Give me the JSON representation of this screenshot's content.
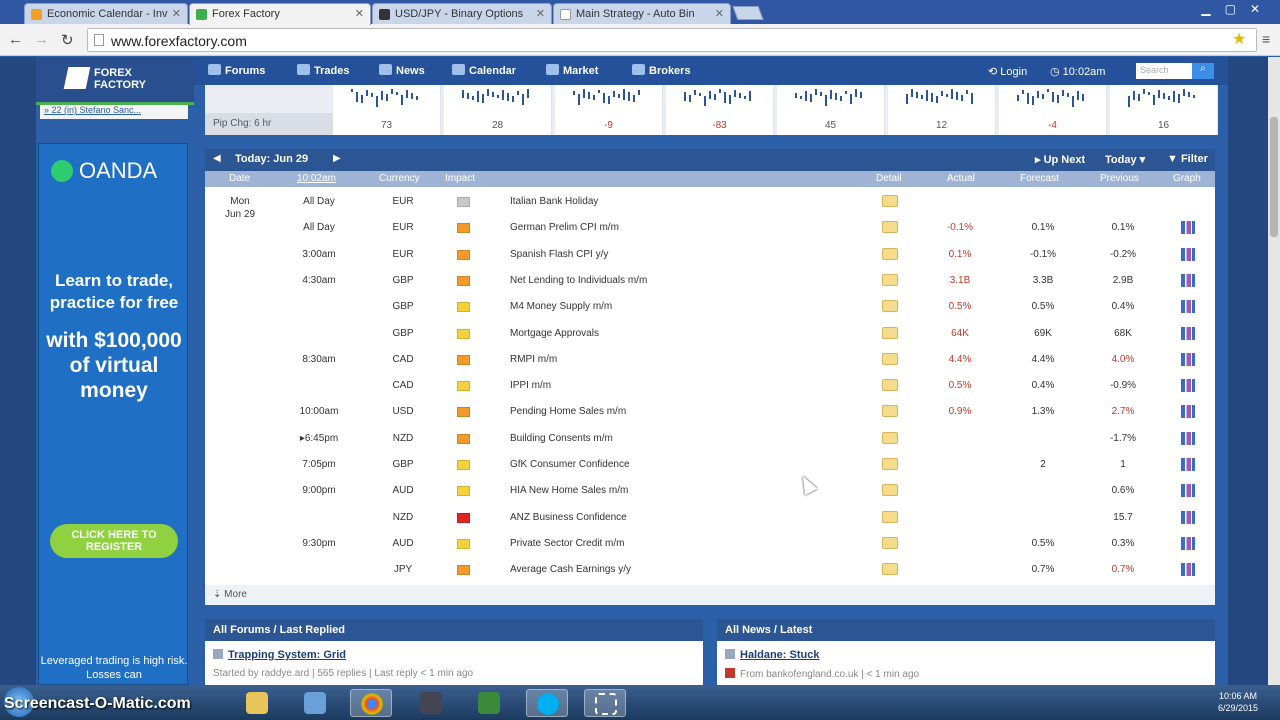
{
  "browser": {
    "tabs": [
      {
        "label": "Economic Calendar - Inv",
        "active": false
      },
      {
        "label": "Forex Factory",
        "active": true
      },
      {
        "label": "USD/JPY - Binary Options",
        "active": false
      },
      {
        "label": "Main Strategy - Auto Bin",
        "active": false
      }
    ],
    "url": "www.forexfactory.com"
  },
  "site": {
    "logo": "FOREX\nFACTORY",
    "nav": [
      "Forums",
      "Trades",
      "News",
      "Calendar",
      "Market",
      "Brokers"
    ],
    "login": "Login",
    "time": "10:02am",
    "search_placeholder": "Search",
    "sidebar_link": "» 22 (in) Stefano Sanc...",
    "pip_label": "Pip Chg: 6 hr",
    "pip_values": [
      "73",
      "28",
      "-9",
      "-83",
      "45",
      "12",
      "-4",
      "16"
    ]
  },
  "ad": {
    "brand": "OANDA",
    "headline": "Learn to trade, practice for free",
    "big": "with $100,000 of virtual money",
    "cta": "CLICK HERE TO REGISTER",
    "risk": "Leveraged trading is high risk. Losses can"
  },
  "calendar": {
    "today": "Today: Jun 29",
    "up_next": "Up Next",
    "today_menu": "Today",
    "filter": "Filter",
    "headers": {
      "date": "Date",
      "time": "10:02am",
      "currency": "Currency",
      "impact": "Impact",
      "detail": "Detail",
      "actual": "Actual",
      "forecast": "Forecast",
      "previous": "Previous",
      "graph": "Graph"
    },
    "day": "Mon\nJun 29",
    "rows": [
      {
        "time": "All Day",
        "cur": "EUR",
        "impact": "gray",
        "event": "Italian Bank Holiday",
        "actual": "",
        "forecast": "",
        "previous": "",
        "prev_mod": false,
        "graph": false
      },
      {
        "time": "All Day",
        "cur": "EUR",
        "impact": "orange",
        "event": "German Prelim CPI m/m",
        "actual": "-0.1%",
        "forecast": "0.1%",
        "previous": "0.1%",
        "prev_mod": false,
        "graph": true
      },
      {
        "time": "3:00am",
        "cur": "EUR",
        "impact": "orange",
        "event": "Spanish Flash CPI y/y",
        "actual": "0.1%",
        "forecast": "-0.1%",
        "previous": "-0.2%",
        "prev_mod": false,
        "graph": true
      },
      {
        "time": "4:30am",
        "cur": "GBP",
        "impact": "orange",
        "event": "Net Lending to Individuals m/m",
        "actual": "3.1B",
        "forecast": "3.3B",
        "previous": "2.9B",
        "prev_mod": false,
        "graph": true
      },
      {
        "time": "",
        "cur": "GBP",
        "impact": "yellow",
        "event": "M4 Money Supply m/m",
        "actual": "0.5%",
        "forecast": "0.5%",
        "previous": "0.4%",
        "prev_mod": false,
        "graph": true
      },
      {
        "time": "",
        "cur": "GBP",
        "impact": "yellow",
        "event": "Mortgage Approvals",
        "actual": "64K",
        "forecast": "69K",
        "previous": "68K",
        "prev_mod": false,
        "graph": true
      },
      {
        "time": "8:30am",
        "cur": "CAD",
        "impact": "orange",
        "event": "RMPI m/m",
        "actual": "4.4%",
        "forecast": "4.4%",
        "previous": "4.0%",
        "prev_mod": true,
        "graph": true
      },
      {
        "time": "",
        "cur": "CAD",
        "impact": "yellow",
        "event": "IPPI m/m",
        "actual": "0.5%",
        "forecast": "0.4%",
        "previous": "-0.9%",
        "prev_mod": false,
        "graph": true
      },
      {
        "time": "10:00am",
        "cur": "USD",
        "impact": "orange",
        "event": "Pending Home Sales m/m",
        "actual": "0.9%",
        "forecast": "1.3%",
        "previous": "2.7%",
        "prev_mod": true,
        "graph": true
      },
      {
        "time": "▸6:45pm",
        "cur": "NZD",
        "impact": "orange",
        "event": "Building Consents m/m",
        "actual": "",
        "forecast": "",
        "previous": "-1.7%",
        "prev_mod": false,
        "graph": true
      },
      {
        "time": "7:05pm",
        "cur": "GBP",
        "impact": "yellow",
        "event": "GfK Consumer Confidence",
        "actual": "",
        "forecast": "2",
        "previous": "1",
        "prev_mod": false,
        "graph": true
      },
      {
        "time": "9:00pm",
        "cur": "AUD",
        "impact": "yellow",
        "event": "HIA New Home Sales m/m",
        "actual": "",
        "forecast": "",
        "previous": "0.6%",
        "prev_mod": false,
        "graph": true
      },
      {
        "time": "",
        "cur": "NZD",
        "impact": "red",
        "event": "ANZ Business Confidence",
        "actual": "",
        "forecast": "",
        "previous": "15.7",
        "prev_mod": false,
        "graph": true
      },
      {
        "time": "9:30pm",
        "cur": "AUD",
        "impact": "yellow",
        "event": "Private Sector Credit m/m",
        "actual": "",
        "forecast": "0.5%",
        "previous": "0.3%",
        "prev_mod": false,
        "graph": true
      },
      {
        "time": "",
        "cur": "JPY",
        "impact": "orange",
        "event": "Average Cash Earnings y/y",
        "actual": "",
        "forecast": "0.7%",
        "previous": "0.7%",
        "prev_mod": true,
        "graph": true
      }
    ],
    "more": "More"
  },
  "forums": {
    "title": "All Forums / Last Replied",
    "link": "Trapping System: Grid",
    "sub": "Started by raddye.ard | 565 replies | Last reply < 1 min ago"
  },
  "news": {
    "title": "All News / Latest",
    "link": "Haldane: Stuck",
    "sub": "From bankofengland.co.uk | < 1 min ago"
  },
  "taskbar": {
    "watermark": "Screencast-O-Matic.com",
    "time": "10:06 AM",
    "date": "6/29/2015"
  },
  "colors": {
    "header": "#25519a",
    "impact_gray": "#c8c8c8",
    "impact_orange": "#f39a2b",
    "impact_yellow": "#f6d23a",
    "impact_red": "#e02424",
    "actual_red": "#c0392b"
  }
}
